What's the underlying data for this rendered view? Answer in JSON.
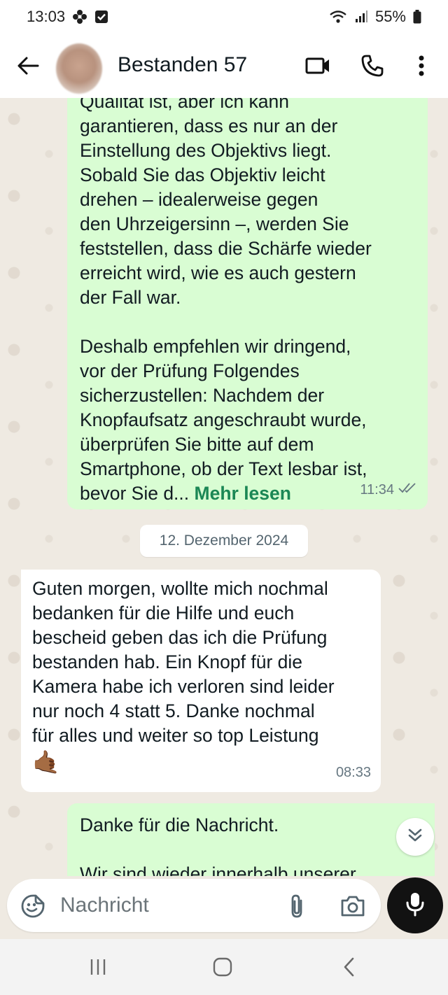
{
  "status_bar": {
    "time": "13:03",
    "battery": "55%",
    "icons": [
      "flower-icon",
      "checkbox-icon",
      "wifi-icon",
      "signal-icon",
      "battery-icon"
    ]
  },
  "header": {
    "title": "Bestanden 57",
    "icons": [
      "back-arrow-icon",
      "video-call-icon",
      "phone-icon",
      "more-vert-icon"
    ]
  },
  "messages": [
    {
      "direction": "outgoing",
      "text_cut": "Qualität ist, aber ich kann",
      "text": "garantieren, dass es nur an der\nEinstellung des Objektivs liegt.\nSobald Sie das Objektiv leicht\ndrehen – idealerweise gegen\nden Uhrzeigersinn –, werden Sie\nfeststellen, dass die Schärfe wieder\nerreicht wird, wie es auch gestern\nder Fall war.\n\nDeshalb empfehlen wir dringend,\nvor der Prüfung Folgendes\nsicherzustellen: Nachdem der\nKnopfaufsatz angeschraubt wurde,\nüberprüfen Sie bitte auf dem\nSmartphone, ob der Text lesbar ist,\nbevor Sie d...",
      "read_more": "Mehr lesen",
      "time": "11:34",
      "status": "read"
    },
    {
      "direction": "incoming",
      "text": "Guten morgen, wollte mich nochmal\nbedanken für die Hilfe und euch\nbescheid geben das ich die Prüfung\nbestanden hab. Ein Knopf für die\nKamera habe ich verloren sind leider\nnur noch 4 statt 5. Danke nochmal\nfür alles und weiter so top Leistung",
      "emoji": "🤙🏾",
      "time": "08:33"
    },
    {
      "direction": "outgoing",
      "text": "Danke für die Nachricht.",
      "text_cut": "Wir sind wieder innerhalb unserer"
    }
  ],
  "date_divider": "12. Dezember 2024",
  "input": {
    "placeholder": "Nachricht",
    "icons": [
      "emoji-sticker-icon",
      "paperclip-icon",
      "camera-icon",
      "microphone-icon"
    ]
  },
  "nav_bar": {
    "icons": [
      "recent-apps-icon",
      "home-icon",
      "back-icon"
    ]
  },
  "colors": {
    "outgoing_bubble": "#d9fdd3",
    "incoming_bubble": "#ffffff",
    "chat_background": "#efeae2",
    "link_green": "#1b8755",
    "mic_button": "#121212"
  }
}
